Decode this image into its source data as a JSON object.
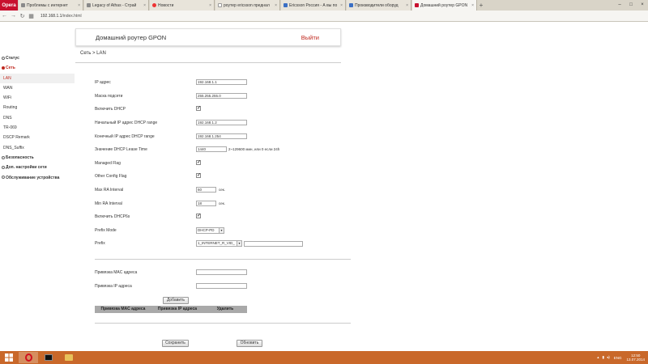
{
  "browser": {
    "opera_label": "Opera",
    "tabs": [
      {
        "title": "Проблемы с интернет",
        "icon": "page-icon",
        "active": false
      },
      {
        "title": "Legacy of Athas - Страй",
        "icon": "page-icon",
        "active": false
      },
      {
        "title": "Новости",
        "icon": "yandex-icon",
        "active": false
      },
      {
        "title": "роутер ericsson преднал",
        "icon": "wiki-icon",
        "active": false
      },
      {
        "title": "Ericsson Россия - А вы по",
        "icon": "page-icon",
        "active": false
      },
      {
        "title": "Производители оборуд",
        "icon": "page-icon",
        "active": false
      },
      {
        "title": "Домашний роутер GPON",
        "icon": "page-icon",
        "active": true
      }
    ],
    "new_tab": "+",
    "url_host": "192.168.1.1",
    "url_path": "/index.html"
  },
  "header": {
    "title": "Домашний роутер GPON",
    "logout": "Выйти"
  },
  "sidebar": {
    "status": "Статус",
    "network": "Сеть",
    "network_items": [
      "LAN",
      "WAN",
      "WiFi",
      "Routing",
      "DNS",
      "TR-069",
      "DSCP Remark",
      "DNS_Suffix"
    ],
    "security": "Безопасность",
    "advanced": "Доп. настройки сети",
    "maintenance": "Обслуживание устройства"
  },
  "breadcrumb": "Сеть > LAN",
  "form": {
    "ip_label": "IP адрес",
    "ip_value": "192.168.1.1",
    "mask_label": "Маска подсети",
    "mask_value": "255.255.255.0",
    "dhcp_label": "Включить DHCP",
    "dhcp_start_label": "Начальный IP адрес DHCP range",
    "dhcp_start_value": "192.168.1.2",
    "dhcp_end_label": "Конечный IP адрес DHCP range",
    "dhcp_end_value": "192.168.1.254",
    "lease_label": "Значение DHCP Lease Time",
    "lease_value": "1440",
    "lease_note": "2~129600 мин, или 0 если 24h",
    "managed_label": "Managed Flag",
    "other_label": "Other Config Flag",
    "max_ra_label": "Max RA Interval",
    "max_ra_value": "60",
    "min_ra_label": "Min RA Interval",
    "min_ra_value": "18",
    "sec_unit": "сек.",
    "dhcp6_label": "Включить DHCP6s",
    "prefix_mode_label": "Prefix Mode",
    "prefix_mode_value": "DHCP-PD",
    "prefix_label": "Prefix",
    "prefix_value": "1_INTERNET_R_VID_"
  },
  "binding": {
    "mac_label": "Привязка MAC адреса",
    "ip_label": "Привязка IP адреса",
    "add_button": "Добавить",
    "col_mac": "Привязка MAC адреса",
    "col_ip": "Привязка IP адреса",
    "col_delete": "Удалить"
  },
  "actions": {
    "save": "Сохранить",
    "refresh": "Обновить"
  },
  "taskbar": {
    "lang": "ENG",
    "time": "12:50",
    "date": "13.07.2014"
  },
  "colors": {
    "accent": "#c0281e",
    "taskbar": "#c9682a"
  }
}
